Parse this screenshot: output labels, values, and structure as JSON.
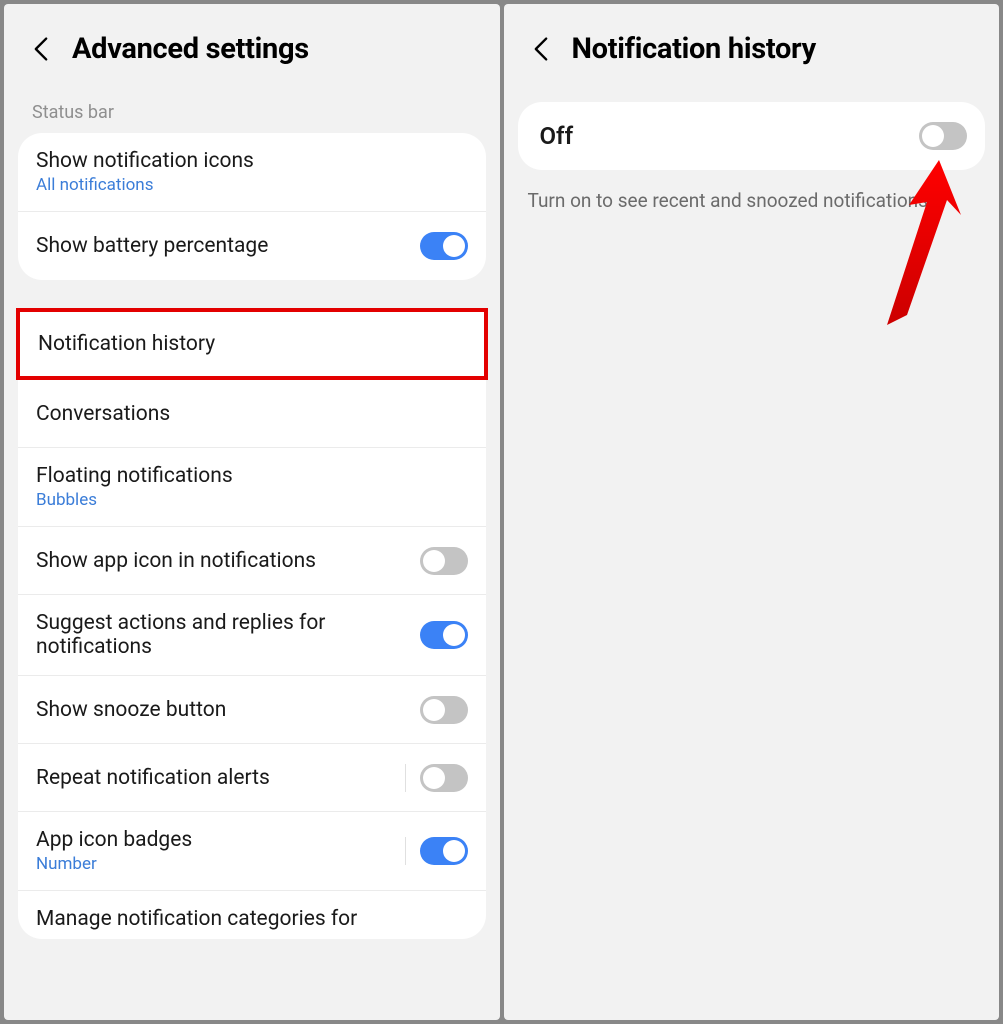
{
  "left": {
    "title": "Advanced settings",
    "section_label": "Status bar",
    "card1": {
      "row1": {
        "title": "Show notification icons",
        "subtitle": "All notifications"
      },
      "row2": {
        "title": "Show battery percentage",
        "toggle": "on"
      }
    },
    "highlighted": {
      "title": "Notification history"
    },
    "card2": {
      "row1": {
        "title": "Conversations"
      },
      "row2": {
        "title": "Floating notifications",
        "subtitle": "Bubbles"
      },
      "row3": {
        "title": "Show app icon in notifications",
        "toggle": "off"
      },
      "row4": {
        "title": "Suggest actions and replies for notifications",
        "toggle": "on"
      },
      "row5": {
        "title": "Show snooze button",
        "toggle": "off"
      },
      "row6": {
        "title": "Repeat notification alerts",
        "toggle": "off"
      },
      "row7": {
        "title": "App icon badges",
        "subtitle": "Number",
        "toggle": "on"
      }
    },
    "truncated": "Manage notification categories for"
  },
  "right": {
    "title": "Notification history",
    "toggle_label": "Off",
    "toggle": "off",
    "description": "Turn on to see recent and snoozed notifications."
  }
}
